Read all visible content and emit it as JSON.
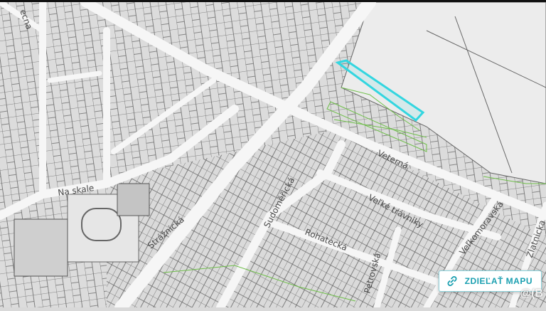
{
  "map": {
    "street_labels": {
      "na_skale": "Na skale",
      "straznicka": "Strážnická",
      "sudomericka": "Sudoměřická",
      "rohatecka": "Rohatecká",
      "veterna": "Veterná",
      "velke_travniky": "Veľké trávniky",
      "petrovska": "Petrovská",
      "velkomoravska": "Veľkomoravská",
      "zlatnicka": "Zlatnicka",
      "top_left": "ecna"
    },
    "colors": {
      "background": "#d9d9d9",
      "road": "#f4f4f4",
      "parcel_line": "#5a5a5a",
      "highlight": "#33d6e0",
      "green_parcel": "#6fbf4a"
    }
  },
  "share_button": {
    "label": "ZDIEĽAŤ MAPU",
    "icon": "link-icon"
  },
  "watermark": {
    "text": "@(B"
  }
}
